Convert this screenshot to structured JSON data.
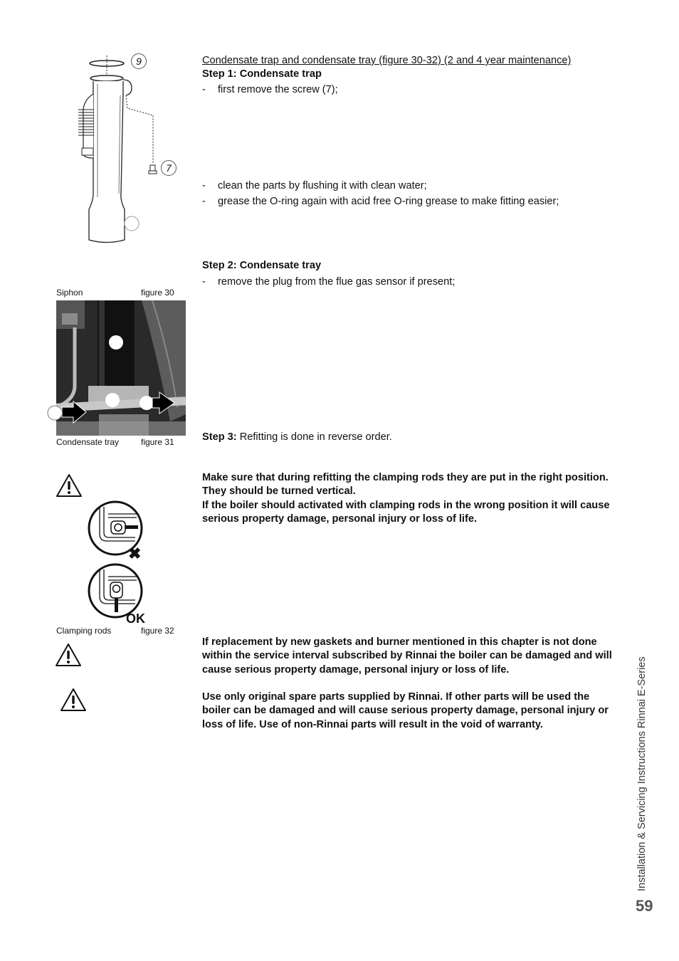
{
  "section": {
    "title": "Condensate trap and condensate tray (figure 30-32) (2 and 4 year maintenance)"
  },
  "step1": {
    "heading": "Step 1: Condensate trap",
    "bullets": [
      "first remove the screw (7);",
      "clean the parts by flushing it with clean water;",
      "grease the O-ring again with acid free O-ring grease to make fitting easier;"
    ]
  },
  "step2": {
    "heading": "Step 2: Condensate tray",
    "bullets": [
      "remove the plug from the flue gas sensor if present;"
    ]
  },
  "step3": {
    "label": "Step 3:",
    "text": " Refitting is done in reverse order."
  },
  "bullet_dash": "-",
  "figures": {
    "fig30": {
      "caption": "Siphon",
      "number": "figure 30",
      "callouts": [
        "9",
        "7"
      ]
    },
    "fig31": {
      "caption": "Condensate tray",
      "number": "figure 31"
    },
    "fig32": {
      "caption": "Clamping rods",
      "number": "figure 32",
      "ok_label": "OK",
      "wrong_mark": "✖"
    }
  },
  "warnings": [
    {
      "lines": [
        "Make sure that during refitting the clamping rods they are put in the right position. They should be turned vertical.",
        "If the boiler should activated with clamping rods in the wrong position it will cause serious property damage, personal injury or loss of life."
      ]
    },
    {
      "lines": [
        "If replacement by new gaskets and burner mentioned in this chapter is not done within the service interval subscribed by Rinnai the boiler can be damaged and will cause serious property damage, personal injury or loss of life."
      ]
    },
    {
      "lines": [
        "Use only original spare parts supplied by Rinnai. If other parts will be used the boiler can be damaged and will cause serious property damage, personal injury or loss of life. Use of non-Rinnai parts will result in the void of warranty."
      ]
    }
  ],
  "footer": {
    "side_title": "Installation & Servicing Instructions Rinnai E-Series",
    "page_number": "59"
  }
}
